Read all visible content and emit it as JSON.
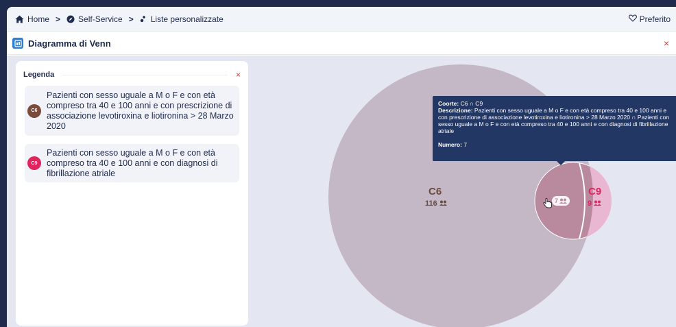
{
  "breadcrumb": {
    "home_label": "Home",
    "self_service_label": "Self-Service",
    "lists_label": "Liste personalizzate",
    "separator": ">"
  },
  "favorite": {
    "label": "Preferito"
  },
  "panel": {
    "title": "Diagramma di Venn",
    "close": "×"
  },
  "legend": {
    "title": "Legenda",
    "close": "×",
    "items": [
      {
        "badge": "C6",
        "color": "#7a4b3a",
        "text": "Pazienti con sesso uguale a M o F e con età compreso tra 40 e 100 anni e con prescrizione di associazione levotiroxina e liotironina > 28 Marzo 2020"
      },
      {
        "badge": "C9",
        "color": "#e0245e",
        "text": "Pazienti con sesso uguale a M o F e con età compreso tra 40 e 100 anni e con diagnosi di fibrillazione atriale"
      }
    ]
  },
  "venn": {
    "c6": {
      "label": "C6",
      "count": "116",
      "fill": "#c4b8c6",
      "text_color": "#6b4a3e"
    },
    "c9": {
      "label": "C9",
      "count": "9",
      "fill": "#e9b7d2",
      "text_color": "#e0245e"
    },
    "intersection": {
      "count": "7",
      "fill": "#b98a9e"
    }
  },
  "tooltip": {
    "coorte_label": "Coorte:",
    "coorte_value": "C6 ∩ C9",
    "descrizione_label": "Descrizione:",
    "descrizione_value": "Pazienti con sesso uguale a M o F e con età compreso tra 40 e 100 anni e con prescrizione di associazione levotiroxina e liotironina > 28 Marzo 2020 ∩ Pazienti con sesso uguale a M o F e con età compreso tra 40 e 100 anni e con diagnosi di fibrillazione atriale",
    "numero_label": "Numero:",
    "numero_value": "7"
  }
}
